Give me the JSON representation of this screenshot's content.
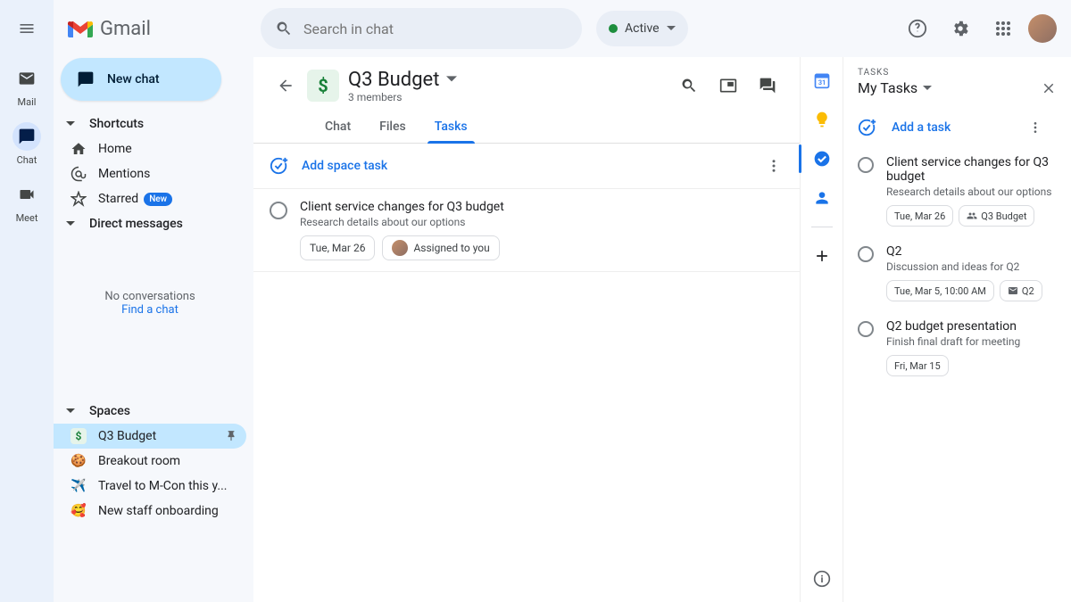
{
  "app": {
    "name": "Gmail"
  },
  "rail": {
    "mail": "Mail",
    "chat": "Chat",
    "meet": "Meet"
  },
  "search": {
    "placeholder": "Search in chat"
  },
  "status": {
    "label": "Active"
  },
  "new_chat": "New chat",
  "sidebar": {
    "shortcuts": "Shortcuts",
    "home": "Home",
    "mentions": "Mentions",
    "starred": "Starred",
    "starred_badge": "New",
    "dm_header": "Direct messages",
    "empty": "No conversations",
    "find_chat": "Find a chat",
    "spaces_header": "Spaces",
    "spaces": [
      {
        "emoji": "$",
        "name": "Q3 Budget",
        "pinned": true,
        "active": true,
        "emoji_is_dollar": true
      },
      {
        "emoji": "🍪",
        "name": "Breakout room"
      },
      {
        "emoji": "✈️",
        "name": "Travel to M-Con this y..."
      },
      {
        "emoji": "🥰",
        "name": "New staff onboarding"
      }
    ]
  },
  "space": {
    "avatar_char": "$",
    "title": "Q3 Budget",
    "subtitle": "3 members",
    "tabs": {
      "chat": "Chat",
      "files": "Files",
      "tasks": "Tasks"
    },
    "add_task": "Add space task",
    "tasks": [
      {
        "title": "Client service changes for Q3 budget",
        "sub": "Research details about our options",
        "date": "Tue, Mar 26",
        "assigned": "Assigned to you"
      }
    ]
  },
  "tasks_panel": {
    "eyebrow": "TASKS",
    "title": "My Tasks",
    "add": "Add a task",
    "items": [
      {
        "title": "Client service changes for Q3 budget",
        "sub": "Research details about our options",
        "date": "Tue, Mar 26",
        "space": "Q3 Budget"
      },
      {
        "title": "Q2",
        "sub": "Discussion and ideas for Q2",
        "date": "Tue, Mar 5, 10:00 AM",
        "mail": "Q2"
      },
      {
        "title": "Q2 budget presentation",
        "sub": "Finish final draft for meeting",
        "date": "Fri, Mar 15"
      }
    ]
  }
}
